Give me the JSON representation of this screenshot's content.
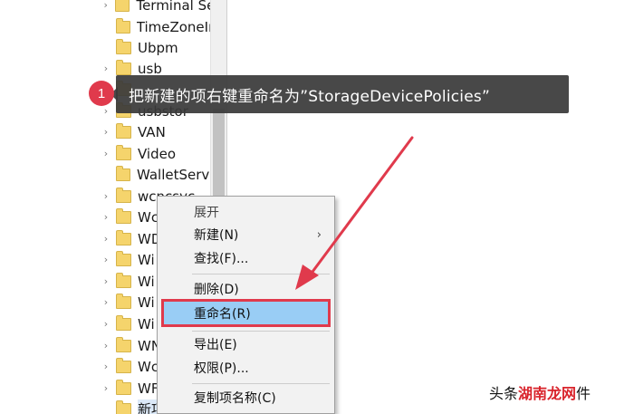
{
  "tree": {
    "items": [
      {
        "label": "Terminal Se",
        "expandable": true
      },
      {
        "label": "TimeZoneIr",
        "expandable": false
      },
      {
        "label": "Ubpm",
        "expandable": false
      },
      {
        "label": "usb",
        "expandable": true
      },
      {
        "label": "",
        "expandable": true
      },
      {
        "label": "usbstor",
        "expandable": true
      },
      {
        "label": "VAN",
        "expandable": true
      },
      {
        "label": "Video",
        "expandable": true
      },
      {
        "label": "WalletServi",
        "expandable": false
      },
      {
        "label": "wcncsvc",
        "expandable": true
      },
      {
        "label": "Wc",
        "expandable": true
      },
      {
        "label": "WD",
        "expandable": true
      },
      {
        "label": "Wi",
        "expandable": true
      },
      {
        "label": "Wi",
        "expandable": true
      },
      {
        "label": "Wi",
        "expandable": true
      },
      {
        "label": "Wi",
        "expandable": true
      },
      {
        "label": "WN",
        "expandable": true
      },
      {
        "label": "Wc",
        "expandable": true
      },
      {
        "label": "WF",
        "expandable": true
      },
      {
        "label": "新项",
        "expandable": false
      }
    ]
  },
  "context_menu": {
    "items": [
      {
        "label": "展开",
        "disabled": true
      },
      {
        "label": "新建(N)",
        "submenu": true
      },
      {
        "label": "查找(F)..."
      },
      {
        "label": "删除(D)"
      },
      {
        "label": "重命名(R)",
        "highlighted": true
      },
      {
        "label": "导出(E)"
      },
      {
        "label": "权限(P)..."
      },
      {
        "label": "复制项名称(C)"
      }
    ]
  },
  "callout": {
    "step": "1",
    "text": "把新建的项右键重命名为”StorageDevicePolicies”"
  },
  "watermark": {
    "prefix": "头条",
    "highlight": "湖南龙网",
    "suffix": "件"
  },
  "colors": {
    "highlight_bg": "#99cdf5",
    "annotation_red": "#e03a4c",
    "callout_bg": "#3a3a3a"
  }
}
